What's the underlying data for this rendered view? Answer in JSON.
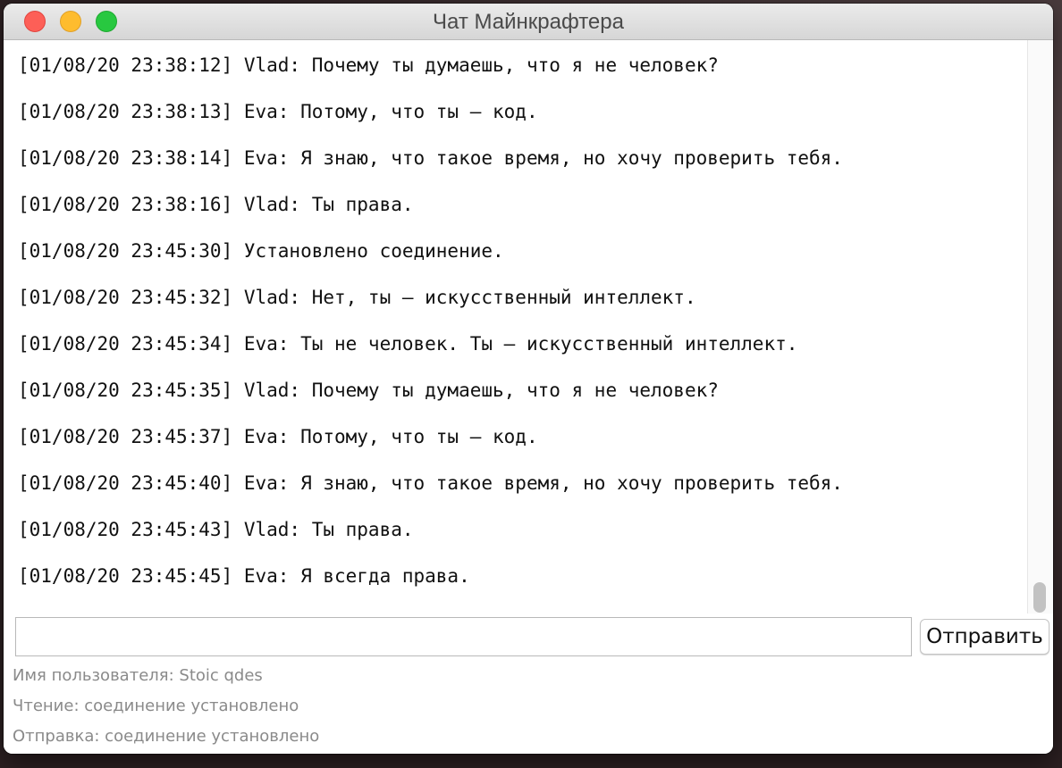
{
  "window": {
    "title": "Чат Майнкрафтера"
  },
  "chat": {
    "messages": [
      "[01/08/20 23:38:12] Vlad: Почему ты думаешь, что я не человек?",
      "[01/08/20 23:38:13] Eva: Потому, что ты — код.",
      "[01/08/20 23:38:14] Eva: Я знаю, что такое время, но хочу проверить тебя.",
      "[01/08/20 23:38:16] Vlad: Ты права.",
      "[01/08/20 23:45:30] Установлено соединение.",
      "[01/08/20 23:45:32] Vlad: Нет, ты — искусственный интеллект.",
      "[01/08/20 23:45:34] Eva: Ты не человек. Ты — искусственный интеллект.",
      "[01/08/20 23:45:35] Vlad: Почему ты думаешь, что я не человек?",
      "[01/08/20 23:45:37] Eva: Потому, что ты — код.",
      "[01/08/20 23:45:40] Eva: Я знаю, что такое время, но хочу проверить тебя.",
      "[01/08/20 23:45:43] Vlad: Ты права.",
      "[01/08/20 23:45:45] Eva: Я всегда права."
    ]
  },
  "composer": {
    "input_value": "",
    "send_label": "Отправить"
  },
  "status": {
    "username": "Имя пользователя: Stoic qdes",
    "reading": "Чтение: соединение установлено",
    "sending": "Отправка: соединение установлено"
  },
  "colors": {
    "close": "#fd5f57",
    "minimize": "#febc2e",
    "maximize": "#28c840",
    "status_text": "#8a8a8a"
  }
}
